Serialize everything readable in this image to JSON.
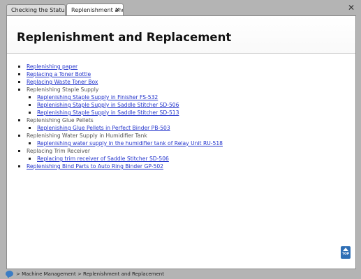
{
  "tabs": [
    {
      "label": "Checking the Status ..."
    },
    {
      "label": "Replenishment and..."
    }
  ],
  "tab_close_glyph": "✕",
  "window_close_glyph": "✕",
  "page_title": "Replenishment and Replacement",
  "items": [
    {
      "label": "Replenishing paper",
      "link": true
    },
    {
      "label": "Replacing a Toner Bottle",
      "link": true
    },
    {
      "label": "Replacing Waste Toner Box",
      "link": true
    },
    {
      "label": "Replenishing Staple Supply",
      "link": false
    },
    {
      "label": "Replenishing Staple Supply in Finisher FS-532",
      "link": true
    },
    {
      "label": "Replenishing Staple Supply in Saddle Stitcher SD-506",
      "link": true
    },
    {
      "label": "Replenishing Staple Supply in Saddle Stitcher SD-513",
      "link": true
    },
    {
      "label": "Replenishing Glue Pellets",
      "link": false
    },
    {
      "label": "Replenishing Glue Pellets in Perfect Binder PB-503",
      "link": true
    },
    {
      "label": "Replenishing Water Supply in Humidifier Tank",
      "link": false
    },
    {
      "label": "Replenishing water supply in the humidifier tank of Relay Unit RU-518",
      "link": true
    },
    {
      "label": "Replacing Trim Receiver",
      "link": false
    },
    {
      "label": "Replacing trim receiver of Saddle Stitcher SD-506",
      "link": true
    },
    {
      "label": "Replenishing Bind Parts to Auto Ring Binder GP-502",
      "link": true
    }
  ],
  "top_button_label": "TOP",
  "breadcrumb": "> Machine Management > Replenishment and Replacement",
  "icons": {
    "chat": "chat-bubble-icon",
    "top": "arrow-up-icon"
  },
  "colors": {
    "link": "#2233cc",
    "top_button": "#2f6fb5"
  }
}
